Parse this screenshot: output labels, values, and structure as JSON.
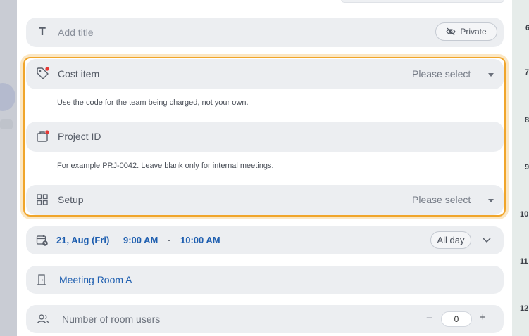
{
  "title_row": {
    "placeholder": "Add title",
    "private_label": "Private"
  },
  "cost_item": {
    "label": "Cost item",
    "select_text": "Please select",
    "hint": "Use the code for the team being charged, not your own."
  },
  "project_id": {
    "label": "Project ID",
    "hint": "For example PRJ-0042. Leave blank only for internal meetings."
  },
  "setup": {
    "label": "Setup",
    "select_text": "Please select"
  },
  "datetime": {
    "date": "21, Aug (Fri)",
    "start": "9:00 AM",
    "separator": "-",
    "end": "10:00 AM",
    "all_day_label": "All day"
  },
  "room": {
    "label": "Meeting Room A"
  },
  "room_users": {
    "label": "Number of room users",
    "minus": "−",
    "value": "0",
    "plus": "+"
  },
  "calendar_hours": [
    "6",
    "7",
    "8",
    "9",
    "10",
    "11",
    "12"
  ],
  "colors": {
    "highlight": "#f0a52a",
    "link_blue": "#1f5fb0",
    "required_dot": "#e53935"
  }
}
